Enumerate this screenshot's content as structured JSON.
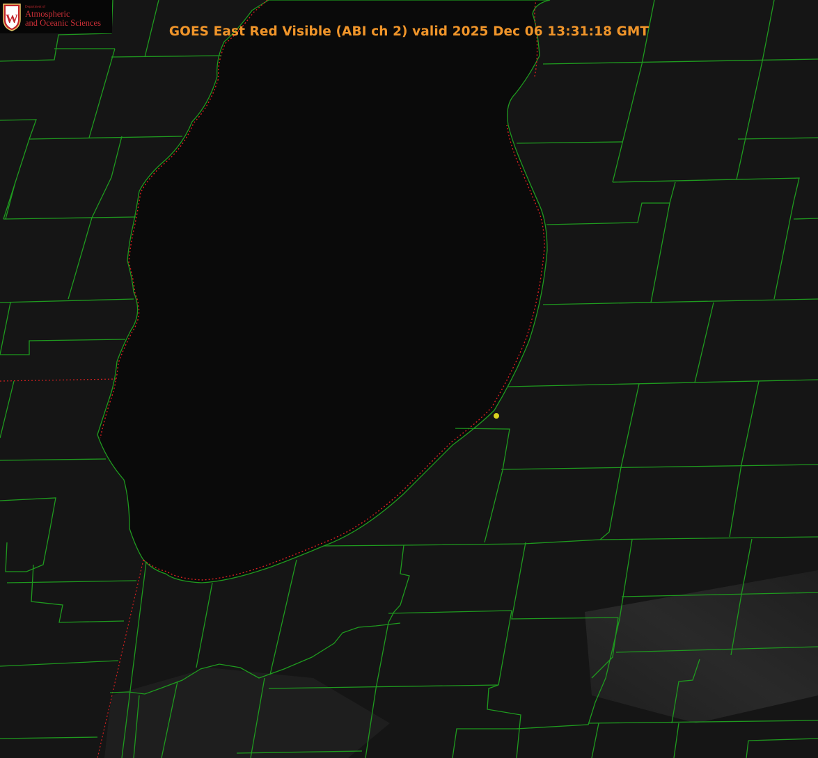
{
  "title": "GOES East Red Visible (ABI ch 2) valid 2025 Dec 06 13:31:18 GMT",
  "logo": {
    "department_line": "Department of",
    "name_line1": "Atmospheric",
    "name_line2": "and Oceanic Sciences",
    "shield_letter": "W"
  },
  "colors": {
    "title": "#f0952a",
    "county_lines": "#1f9a1f",
    "state_line": "#d42020",
    "station_marker": "#d8d020",
    "logo_red": "#c2272d"
  },
  "map": {
    "product": "GOES East Red Visible",
    "water_body": "lake",
    "marker": "station-dot"
  }
}
